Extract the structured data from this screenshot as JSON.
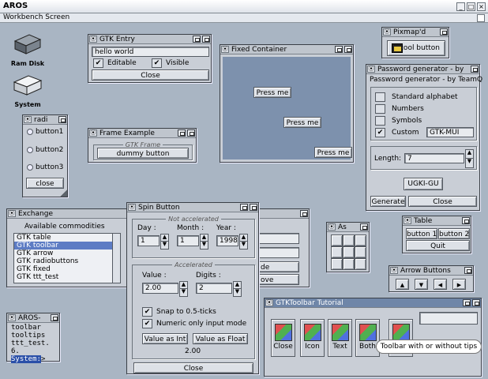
{
  "host": {
    "title": "AROS"
  },
  "workbench": {
    "title": "Workbench Screen"
  },
  "desktop": {
    "ramdisk_label": "Ram Disk",
    "system_label": "System"
  },
  "gtk_entry": {
    "title": "GTK Entry",
    "value": "hello world",
    "editable_label": "Editable",
    "visible_label": "Visible",
    "editable_checked": "✔",
    "visible_checked": "✔",
    "close_label": "Close"
  },
  "radio": {
    "title": "radi",
    "items": [
      "button1",
      "button2",
      "button3"
    ],
    "close_label": "close"
  },
  "frame_example": {
    "title": "Frame Example",
    "frame_label": "GTK Frame",
    "button_label": "dummy button"
  },
  "fixed": {
    "title": "Fixed Container",
    "buttons": [
      "Press me",
      "Press me",
      "Press me"
    ]
  },
  "pixmap": {
    "title": "Pixmap'd",
    "button_label": "cool button"
  },
  "password": {
    "title": "Password generator - by",
    "heading": "Password generator - by TeamQ",
    "options": [
      "Standard alphabet",
      "Numbers",
      "Symbols",
      "Custom"
    ],
    "custom_checked": "✔",
    "custom_value": "GTK-MUI",
    "length_label": "Length:",
    "length_value": "7",
    "generated": "UGKI-GU",
    "generate_label": "Generate",
    "close_label": "Close"
  },
  "exchange": {
    "title": "Exchange",
    "heading": "Available commodities",
    "items": [
      "GTK table",
      "GTK toolbar",
      "GTK arrow",
      "GTK radiobuttons",
      "GTK fixed",
      "GTK ttt_test"
    ],
    "selected_index": 1,
    "partial_de": "de",
    "partial_ove": "ove"
  },
  "spin": {
    "title": "Spin Button",
    "not_accel_label": "Not accelerated",
    "day_label": "Day :",
    "month_label": "Month :",
    "year_label": "Year :",
    "day_value": "1",
    "month_value": "1",
    "year_value": "1998",
    "accel_label": "Accelerated",
    "value_label": "Value :",
    "digits_label": "Digits :",
    "value_value": "2.00",
    "digits_value": "2",
    "snap_label": "Snap to 0.5-ticks",
    "numeric_label": "Numeric only input mode",
    "snap_checked": "✔",
    "numeric_checked": "✔",
    "as_int_label": "Value as Int",
    "as_float_label": "Value as Float",
    "result": "2.00",
    "close_label": "Close"
  },
  "as_win": {
    "title": "As"
  },
  "table": {
    "title": "Table",
    "button1": "button 1",
    "button2": "button 2",
    "quit_label": "Quit"
  },
  "arrows": {
    "title": "Arrow Buttons",
    "up": "▲",
    "down": "▼",
    "left": "◀",
    "right": "▶"
  },
  "toolbar": {
    "title": "GTKToolbar Tutorial",
    "buttons": [
      "Close",
      "Icon",
      "Text",
      "Both"
    ],
    "tooltip": "Toolbar with or without tips"
  },
  "shell": {
    "title": "AROS-",
    "lines": [
      "toolbar",
      "tooltips",
      "ttt_test."
    ],
    "prompt": "6.",
    "command": "System:",
    "cursor": ">"
  }
}
